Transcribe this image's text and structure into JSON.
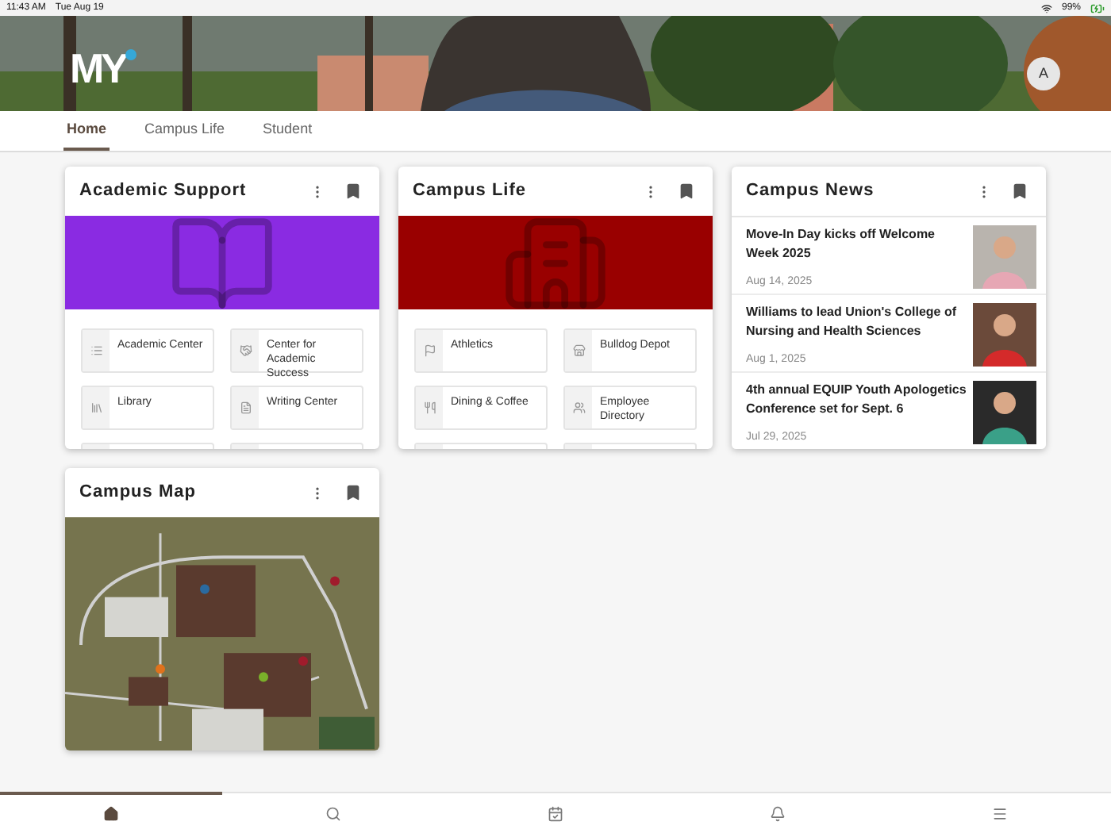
{
  "status_bar": {
    "time": "11:43 AM",
    "date": "Tue Aug 19",
    "battery": "99%"
  },
  "header": {
    "logo": "MY",
    "avatar": "A"
  },
  "tabs": [
    {
      "label": "Home",
      "selected": true
    },
    {
      "label": "Campus Life",
      "selected": false
    },
    {
      "label": "Student",
      "selected": false
    }
  ],
  "cards": [
    {
      "kind": "links",
      "title": "Academic Support",
      "color": "#8a2be2",
      "links": [
        "Academic Center",
        "Center for Academic Success",
        "Library",
        "Writing Center"
      ],
      "more_rows": true
    },
    {
      "kind": "links",
      "title": "Campus Life",
      "color": "#990000",
      "links": [
        "Athletics",
        "Bulldog Depot",
        "Dining & Coffee",
        "Employee Directory"
      ],
      "more_rows": true
    },
    {
      "kind": "news",
      "title": "Campus News",
      "items": [
        {
          "title": "Move-In Day kicks off Welcome Week 2025",
          "date": "Aug 14, 2025"
        },
        {
          "title": "Williams to lead Union's College of Nursing and Health Sciences",
          "date": "Aug 1, 2025"
        },
        {
          "title": "4th annual EQUIP Youth Apologetics Conference set for Sept. 6",
          "date": "Jul 29, 2025"
        }
      ]
    },
    {
      "kind": "map",
      "title": "Campus Map"
    }
  ],
  "bottom_nav": [
    {
      "selected": true
    },
    {
      "selected": false
    },
    {
      "selected": false
    },
    {
      "selected": false
    },
    {
      "selected": false
    }
  ]
}
